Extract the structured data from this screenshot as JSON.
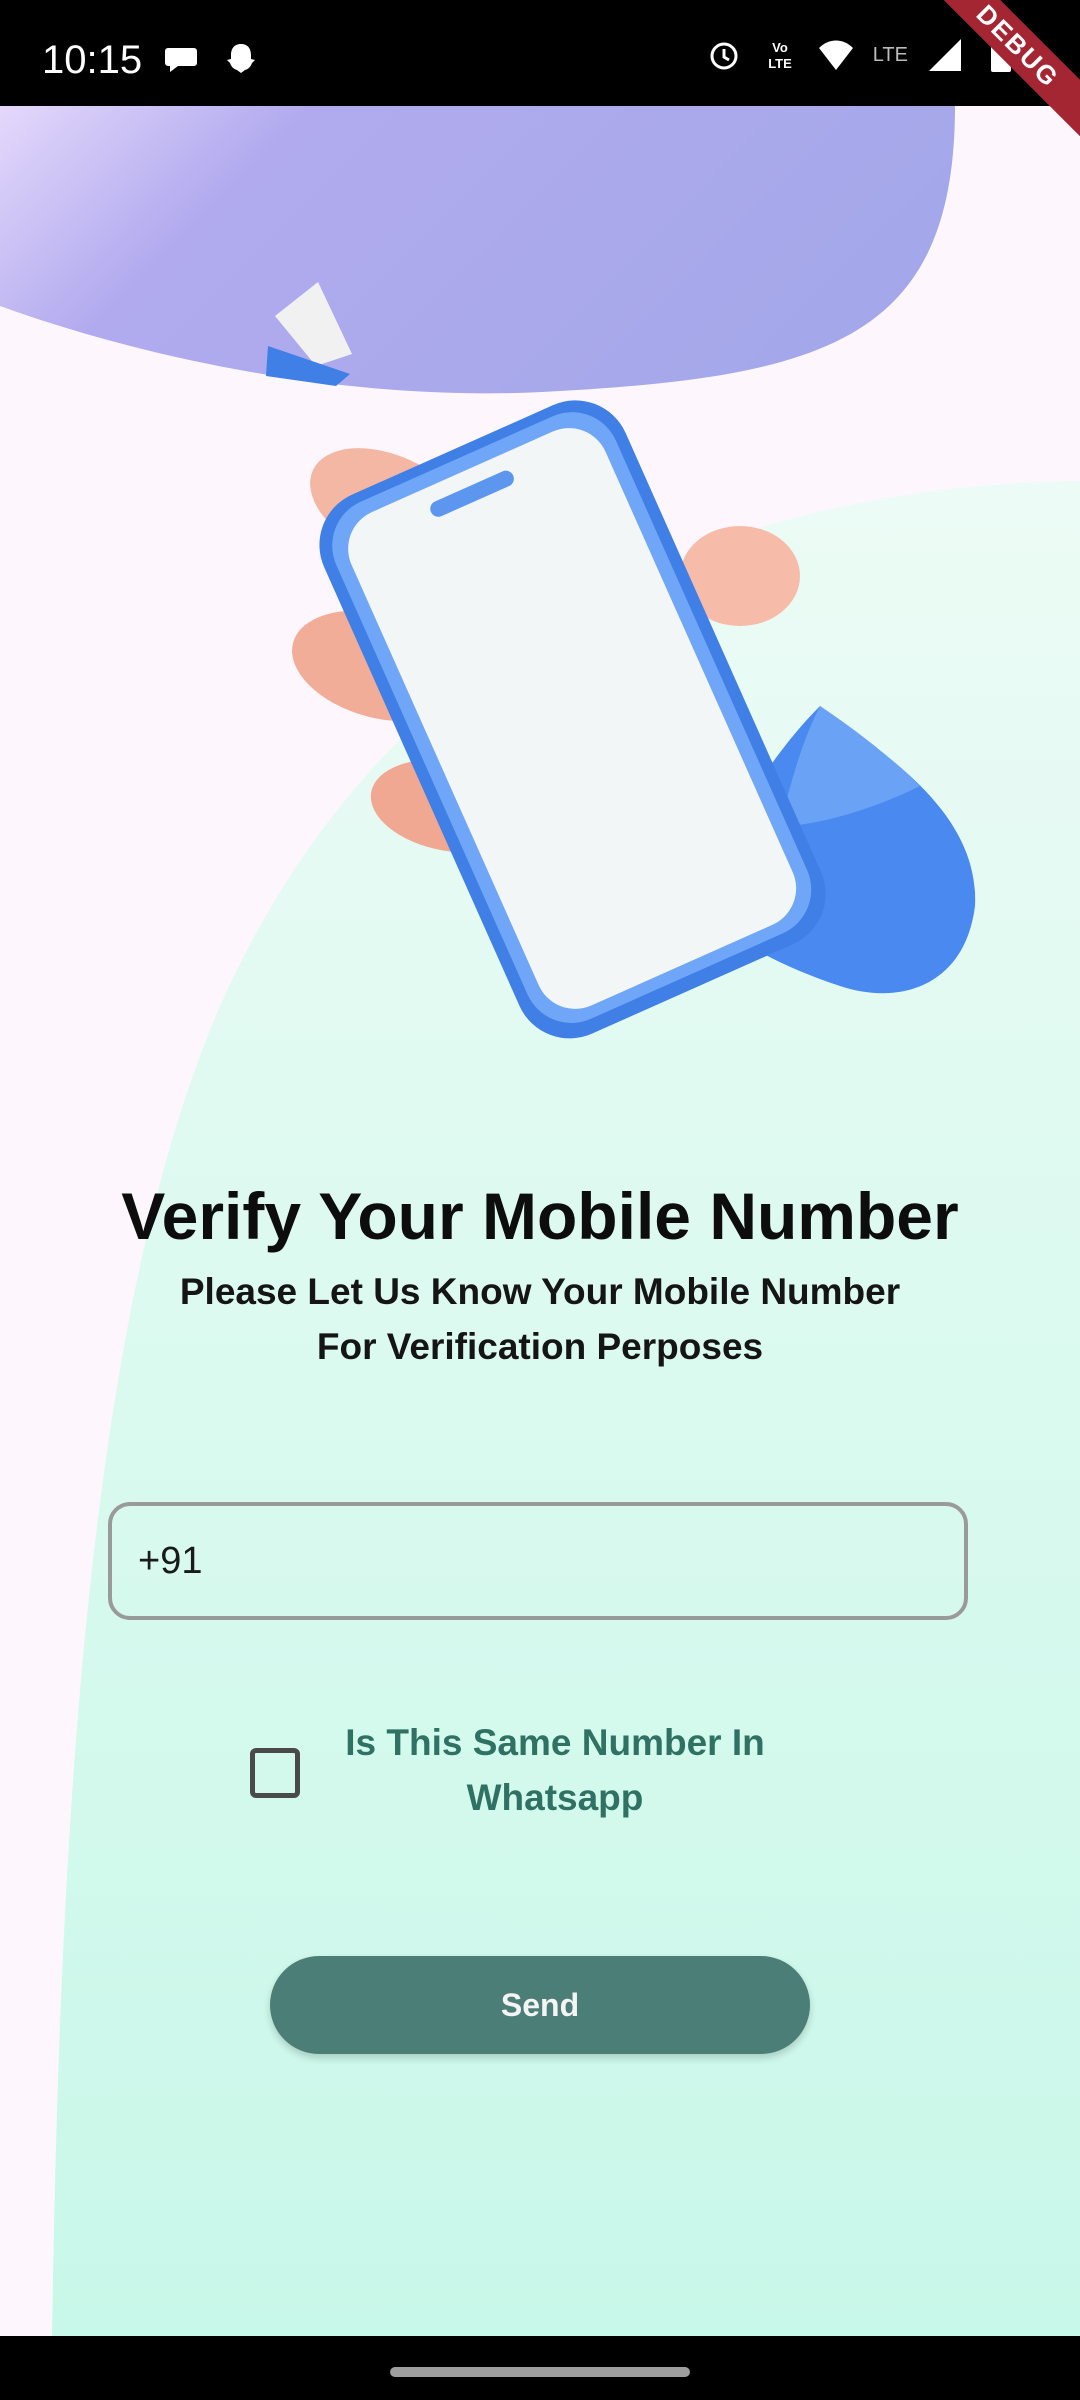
{
  "status_bar": {
    "time": "10:15",
    "left_icons": [
      "chat-bubble-icon",
      "snapchat-ghost-icon"
    ],
    "right_icons": [
      "alarm-icon",
      "volte-icon",
      "wifi-icon",
      "lte-signal-icon",
      "battery-icon"
    ],
    "lte_label": "LTE",
    "debug_banner": "DEBUG"
  },
  "colors": {
    "blob_top": "#a6a8ec",
    "blob_bottom": "#d6fbef",
    "button": "#4b7e76",
    "check_label": "#2f7264"
  },
  "illustration": {
    "name": "hand-holding-phone-illustration"
  },
  "main": {
    "title": "Verify Your Mobile Number",
    "subtitle_line1": "Please Let Us Know Your Mobile Number",
    "subtitle_line2": "For Verification Perposes",
    "phone_input_value": "+91",
    "whatsapp_label_line1": "Is This Same Number In",
    "whatsapp_label_line2": "Whatsapp",
    "whatsapp_checked": false,
    "send_label": "Send"
  }
}
